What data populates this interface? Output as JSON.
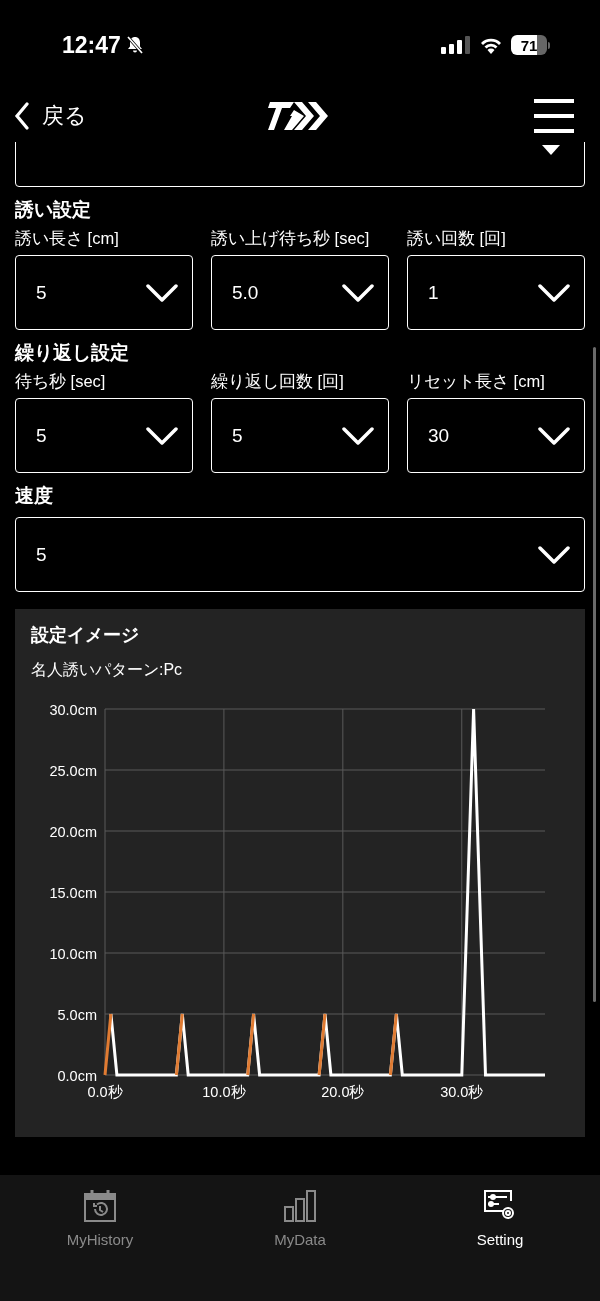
{
  "status_bar": {
    "time": "12:47",
    "battery": "71"
  },
  "nav": {
    "back": "戻る"
  },
  "sections": [
    {
      "title": "誘い設定",
      "fields": [
        {
          "label": "誘い長さ [cm]",
          "value": "5"
        },
        {
          "label": "誘い上げ待ち秒 [sec]",
          "value": "5.0"
        },
        {
          "label": "誘い回数 [回]",
          "value": "1"
        }
      ]
    },
    {
      "title": "繰り返し設定",
      "fields": [
        {
          "label": "待ち秒 [sec]",
          "value": "5"
        },
        {
          "label": "繰り返し回数 [回]",
          "value": "5"
        },
        {
          "label": "リセット長さ [cm]",
          "value": "30"
        }
      ]
    },
    {
      "title": "速度",
      "fields": [
        {
          "value": "5"
        }
      ]
    }
  ],
  "preview": {
    "title": "設定イメージ",
    "subtitle": "名人誘いパターン:Pc",
    "chart_data": {
      "type": "line",
      "x": [
        0,
        0.5,
        1,
        6,
        6.5,
        7,
        12,
        12.5,
        13,
        18,
        18.5,
        19,
        24,
        24.5,
        25,
        30,
        31,
        32,
        37
      ],
      "series": [
        {
          "color": "#ffffff",
          "values": [
            null,
            5,
            0,
            0,
            5,
            0,
            0,
            5,
            0,
            0,
            5,
            0,
            0,
            5,
            0,
            0,
            30,
            0,
            0
          ]
        },
        {
          "color": "#e07b32",
          "values": [
            0,
            5,
            null,
            0,
            5,
            null,
            0,
            5,
            null,
            0,
            5,
            null,
            0,
            5,
            null,
            null,
            null,
            null,
            null
          ]
        }
      ],
      "grid": true,
      "xlim": [
        0,
        37
      ],
      "ylim": [
        0,
        30
      ],
      "xticks": [
        {
          "value": 0,
          "label": "0.0秒"
        },
        {
          "value": 10,
          "label": "10.0秒"
        },
        {
          "value": 20,
          "label": "20.0秒"
        },
        {
          "value": 30,
          "label": "30.0秒"
        }
      ],
      "yticks": [
        {
          "value": 0,
          "label": "0.0cm"
        },
        {
          "value": 5,
          "label": "5.0cm"
        },
        {
          "value": 10,
          "label": "10.0cm"
        },
        {
          "value": 15,
          "label": "15.0cm"
        },
        {
          "value": 20,
          "label": "20.0cm"
        },
        {
          "value": 25,
          "label": "25.0cm"
        },
        {
          "value": 30,
          "label": "30.0cm"
        }
      ]
    }
  },
  "tabs": [
    {
      "label": "MyHistory",
      "selected": false
    },
    {
      "label": "MyData",
      "selected": false
    },
    {
      "label": "Setting",
      "selected": true
    }
  ]
}
